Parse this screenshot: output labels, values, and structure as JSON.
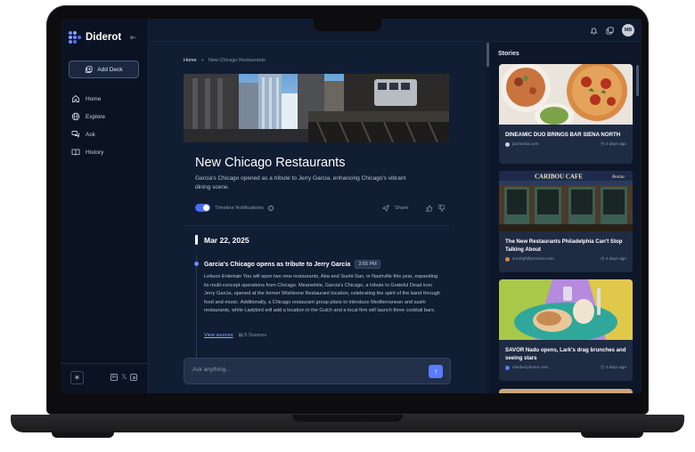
{
  "app": {
    "name": "Diderot"
  },
  "sidebar": {
    "add_deck": "Add Deck",
    "items": [
      {
        "label": "Home",
        "icon": "home-icon"
      },
      {
        "label": "Explore",
        "icon": "globe-icon"
      },
      {
        "label": "Ask",
        "icon": "chat-icon"
      },
      {
        "label": "History",
        "icon": "book-icon"
      }
    ]
  },
  "topbar": {
    "avatar_initials": "MB"
  },
  "breadcrumb": {
    "home": "Home",
    "separator": ">",
    "current": "New Chicago Restaurants"
  },
  "article": {
    "title": "New Chicago Restaurants",
    "subtitle": "Garcia's Chicago opened as a tribute to Jerry Garcia, enhancing Chicago's vibrant dining scene.",
    "notifications_label": "Timeline Notifications",
    "share_label": "Share"
  },
  "timeline": {
    "date": "Mar 22, 2025",
    "event_title": "Garcia's Chicago opens as tribute to Jerry Garcia",
    "event_time": "3:55 PM",
    "event_body": "Lettuce Entertain You will open two new restaurants, Aba and Sushi-San, in Nashville this year, expanding its multi-concept operations from Chicago. Meanwhile, Garcia's Chicago, a tribute to Grateful Dead icon Jerry Garcia, opened at the former Wishbone Restaurant location, celebrating the spirit of the band through food and music. Additionally, a Chicago restaurant group plans to introduce Mediterranean and sushi restaurants, while Ladybird will add a location in the Gulch and a local firm will launch three cocktail bars.",
    "view_sources": "View sources",
    "sources_count": "5 Sources"
  },
  "ask": {
    "placeholder": "Ask anything..."
  },
  "stories": {
    "heading": "Stories",
    "items": [
      {
        "title": "DINEAMIC DUO BRINGS BAR SIENA NORTH",
        "source": "jacmedia.com",
        "time": "3 days ago"
      },
      {
        "title": "The New Restaurants Philadelphia Can't Stop Talking About",
        "source": "southphillyreview.com",
        "time": "3 days ago"
      },
      {
        "title": "SAVOR Nadu opens, Lark's drag brunches and seeing stars",
        "source": "elindaciytimes.com",
        "time": "4 days ago"
      }
    ],
    "caribou_sign": "CARIBOU CAFE",
    "caribou_sign2": "Restau"
  },
  "colors": {
    "accent": "#5b7bff",
    "background": "#0f1a2e",
    "sidebar": "#0b1322"
  }
}
